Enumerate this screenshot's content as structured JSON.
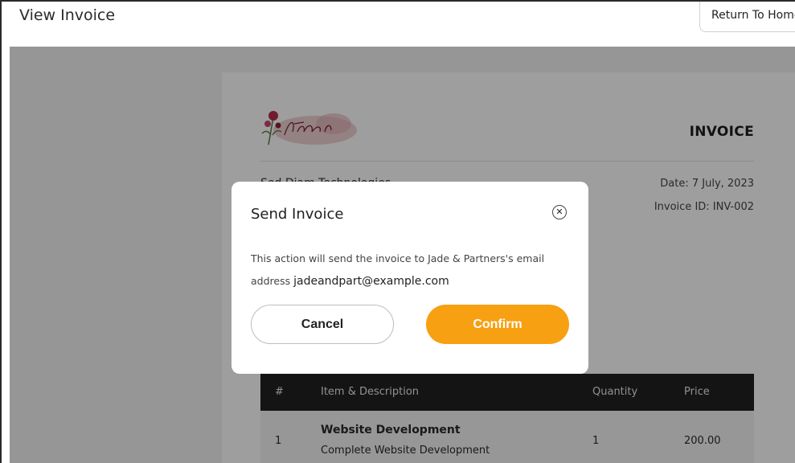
{
  "header": {
    "title": "View Invoice",
    "return_label": "Return To Home"
  },
  "invoice": {
    "heading": "INVOICE",
    "from_name": "Sed Diam Technologies",
    "date": "Date: 7 July, 2023",
    "invoice_id": "Invoice ID: INV-002",
    "table": {
      "headers": [
        "#",
        "Item & Description",
        "Quantity",
        "Price"
      ],
      "rows": [
        {
          "num": "1",
          "title": "Website Development",
          "desc": "Complete Website Development",
          "qty": "1",
          "price": "200.00"
        }
      ]
    }
  },
  "modal": {
    "title": "Send Invoice",
    "message": "This action will send the invoice to Jade & Partners's email address",
    "email": "jadeandpart@example.com",
    "cancel_label": "Cancel",
    "confirm_label": "Confirm"
  },
  "colors": {
    "accent": "#f7a012",
    "table_header": "#212121"
  }
}
